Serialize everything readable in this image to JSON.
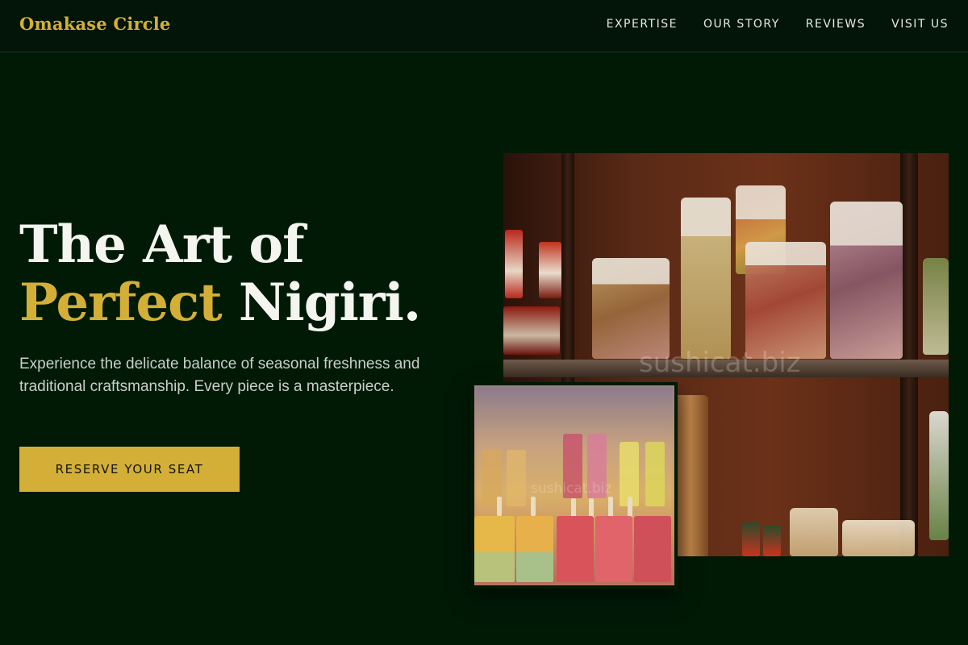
{
  "brand": {
    "name": "Omakase Circle"
  },
  "nav": {
    "links": [
      "EXPERTISE",
      "OUR STORY",
      "REVIEWS",
      "VISIT US"
    ]
  },
  "hero": {
    "title_line1": "The Art of",
    "title_accent": "Perfect",
    "title_rest": " Nigiri.",
    "description": "Experience the delicate balance of seasonal freshness and traditional craftsmanship. Every piece is a masterpiece.",
    "cta_label": "RESERVE YOUR SEAT"
  },
  "images": {
    "large_watermark": "sushicat.biz",
    "small_watermark": "sushicat.biz"
  },
  "colors": {
    "background": "#001a06",
    "accent": "#d4af37",
    "text": "#f5f5f0"
  }
}
